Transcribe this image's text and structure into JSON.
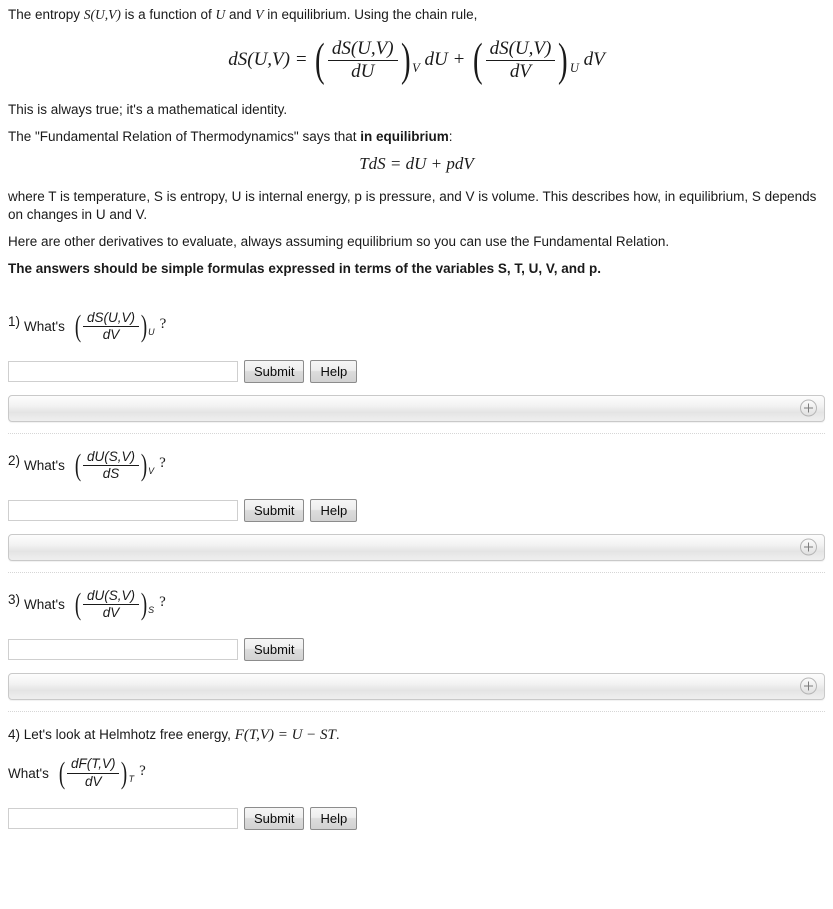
{
  "intro": {
    "line1_a": "The entropy ",
    "line1_math": "S(U,V)",
    "line1_b": " is a function of ",
    "line1_u": "U",
    "line1_c": " and ",
    "line1_v": "V",
    "line1_d": " in equilibrium. Using the chain rule,",
    "chain_rule_eq": {
      "lhs": "dS(U,V)",
      "eq": "=",
      "term1_num": "dS(U,V)",
      "term1_den": "dU",
      "term1_sub": "V",
      "term1_tail": "dU",
      "plus": "+",
      "term2_num": "dS(U,V)",
      "term2_den": "dV",
      "term2_sub": "U",
      "term2_tail": "dV"
    },
    "identity_note": "This is always true; it's a mathematical identity.",
    "fundamental_a": "The \"Fundamental Relation of Thermodynamics\" says that ",
    "fundamental_bold": "in equilibrium",
    "fundamental_b": ":",
    "fundamental_eq": "TdS = dU + pdV",
    "where_text": "where T is temperature, S is entropy, U is internal energy, p is pressure, and V is volume. This describes how, in equilibrium, S depends on changes in U and V.",
    "derivatives_text": "Here are other derivatives to evaluate, always assuming equilibrium so you can use the Fundamental Relation.",
    "answers_note": "The answers should be simple formulas expressed in terms of the variables S, T, U, V, and p."
  },
  "questions": [
    {
      "number": "1)",
      "prompt": "What's",
      "num": "dS(U,V)",
      "den": "dV",
      "sub": "U",
      "qmark": "?",
      "input_value": "",
      "submit_label": "Submit",
      "help_label": "Help",
      "has_help": true
    },
    {
      "number": "2)",
      "prompt": "What's",
      "num": "dU(S,V)",
      "den": "dS",
      "sub": "V",
      "qmark": "?",
      "input_value": "",
      "submit_label": "Submit",
      "help_label": "Help",
      "has_help": true
    },
    {
      "number": "3)",
      "prompt": "What's",
      "num": "dU(S,V)",
      "den": "dV",
      "sub": "S",
      "qmark": "?",
      "input_value": "",
      "submit_label": "Submit",
      "help_label": "",
      "has_help": false
    }
  ],
  "question4": {
    "lead_text": "4) Let's look at Helmhotz free energy, ",
    "lead_math": "F(T,V) = U − ST",
    "lead_period": ".",
    "prompt": "What's",
    "num": "dF(T,V)",
    "den": "dV",
    "sub": "T",
    "qmark": "?",
    "input_value": "",
    "submit_label": "Submit",
    "help_label": "Help"
  },
  "icons": {
    "expand_plus": "plus-icon"
  }
}
